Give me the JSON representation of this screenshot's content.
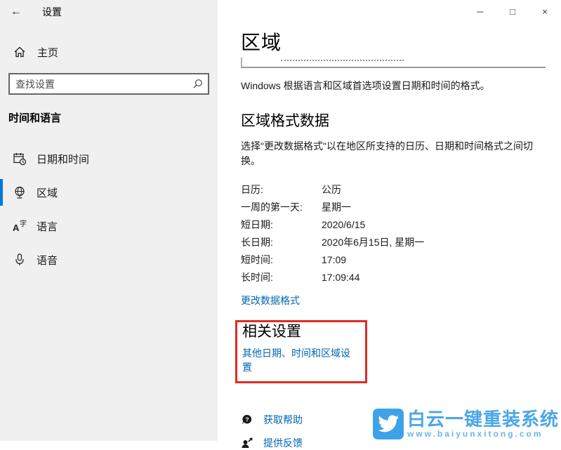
{
  "titlebar": {
    "back": "←",
    "title": "设置",
    "minimize": "─",
    "maximize": "□",
    "close": "×"
  },
  "sidebar": {
    "home_label": "主页",
    "search_placeholder": "查找设置",
    "section_title": "时间和语言",
    "items": [
      {
        "label": "日期和时间",
        "selected": false
      },
      {
        "label": "区域",
        "selected": true
      },
      {
        "label": "语言",
        "selected": false
      },
      {
        "label": "语音",
        "selected": false
      }
    ]
  },
  "main": {
    "page_title": "区域",
    "intro": "Windows 根据语言和区域首选项设置日期和时间的格式。",
    "format_section": {
      "title": "区域格式数据",
      "description": "选择\"更改数据格式\"以在地区所支持的日历、日期和时间格式之间切换。",
      "rows": [
        {
          "label": "日历:",
          "value": "公历"
        },
        {
          "label": "一周的第一天:",
          "value": "星期一"
        },
        {
          "label": "短日期:",
          "value": "2020/6/15"
        },
        {
          "label": "长日期:",
          "value": "2020年6月15日, 星期一"
        },
        {
          "label": "短时间:",
          "value": "17:09"
        },
        {
          "label": "长时间:",
          "value": "17:09:44"
        }
      ],
      "change_link": "更改数据格式"
    },
    "related": {
      "title": "相关设置",
      "link": "其他日期、时间和区域设置"
    },
    "help_links": [
      {
        "label": "获取帮助"
      },
      {
        "label": "提供反馈"
      }
    ]
  },
  "watermark": {
    "title": "白云一键重装系统",
    "url": "www.baiyunxitong.com"
  },
  "colors": {
    "accent": "#0078d7",
    "link": "#0066b4",
    "annotation_red": "#e12a22",
    "watermark_blue": "#3fa2e9",
    "sidebar_bg": "#f0f0f1"
  }
}
